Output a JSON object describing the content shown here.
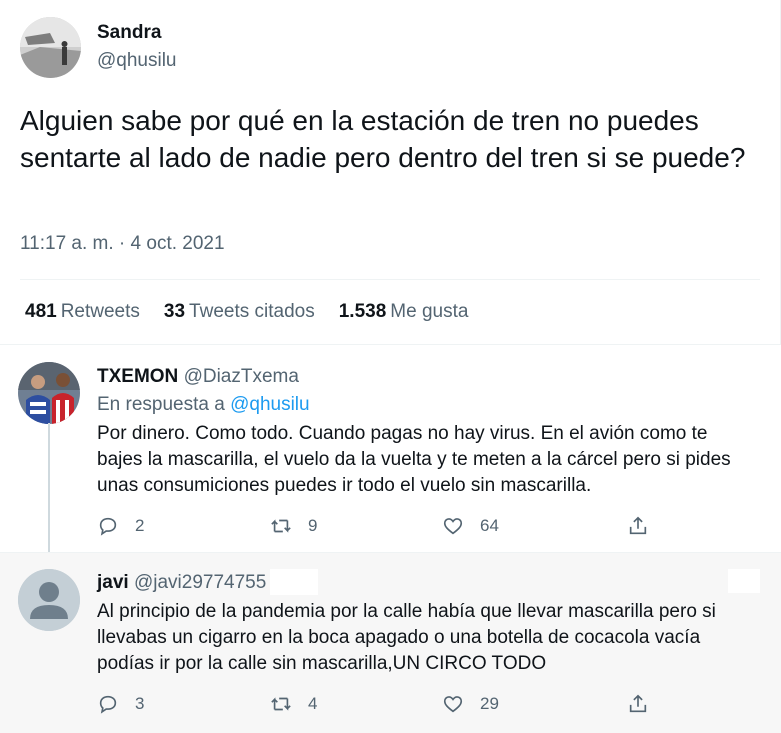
{
  "main_tweet": {
    "author_name": "Sandra",
    "author_handle": "@qhusilu",
    "text": "Alguien sabe por qué en la estación de tren no puedes sentarte al lado de nadie pero dentro del tren si se puede?",
    "timestamp": "11:17 a. m. · 4 oct. 2021",
    "stats": [
      {
        "count": "481",
        "label": "Retweets"
      },
      {
        "count": "33",
        "label": "Tweets citados"
      },
      {
        "count": "1.538",
        "label": "Me gusta"
      }
    ]
  },
  "replies": [
    {
      "name": "TXEMON",
      "handle": "@DiazTxema",
      "reply_prefix": "En respuesta a",
      "reply_to": "@qhusilu",
      "text": "Por dinero. Como todo. Cuando pagas no hay virus. En el avión como te bajes la mascarilla, el vuelo da la vuelta y te meten a la cárcel pero si pides unas consumiciones puedes ir todo el vuelo sin mascarilla.",
      "replies_count": "2",
      "retweets_count": "9",
      "likes_count": "64"
    },
    {
      "name": "javi",
      "handle": "@javi29774755",
      "text": "Al principio de la pandemia por la calle había que llevar mascarilla pero si llevabas un cigarro en la boca apagado o una botella de cocacola vacía podías ir por la calle sin mascarilla,UN CIRCO TODO",
      "replies_count": "3",
      "retweets_count": "4",
      "likes_count": "29"
    }
  ],
  "icons": {
    "reply": "reply-icon",
    "retweet": "retweet-icon",
    "like": "heart-icon",
    "share": "share-icon"
  },
  "colors": {
    "link": "#1d9bf0",
    "secondary_text": "#536471",
    "primary_text": "#0f1419"
  }
}
